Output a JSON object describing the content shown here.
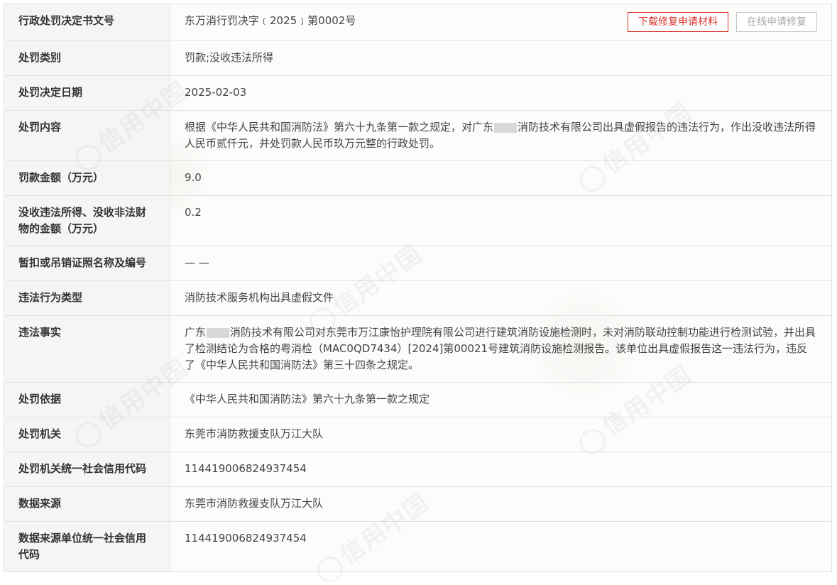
{
  "buttons": {
    "download": "下载修复申请材料",
    "online": "在线申请修复"
  },
  "watermark": "信用中国",
  "rows": {
    "decision_no": {
      "label": "行政处罚决定书文号",
      "value": "东万消行罚决字﹝2025﹞第0002号"
    },
    "category": {
      "label": "处罚类别",
      "value": "罚款;没收违法所得"
    },
    "date": {
      "label": "处罚决定日期",
      "value": "2025-02-03"
    },
    "content": {
      "label": "处罚内容",
      "value_pre": "根据《中华人民共和国消防法》第六十九条第一款之规定，对广东",
      "value_post": "消防技术有限公司出具虚假报告的违法行为，作出没收违法所得人民币贰仟元，并处罚款人民币玖万元整的行政处罚。"
    },
    "fine": {
      "label": "罚款金额（万元）",
      "value": "9.0"
    },
    "confiscation": {
      "label": "没收违法所得、没收非法财物的金额（万元）",
      "value": "0.2"
    },
    "license": {
      "label": "暂扣或吊销证照名称及编号",
      "value": "— —"
    },
    "violation_type": {
      "label": "违法行为类型",
      "value": "消防技术服务机构出具虚假文件"
    },
    "facts": {
      "label": "违法事实",
      "value_pre": "广东",
      "value_post": "消防技术有限公司对东莞市万江康怡护理院有限公司进行建筑消防设施检测时，未对消防联动控制功能进行检测试验，并出具了检测结论为合格的粤消检（MAC0QD7434）[2024]第00021号建筑消防设施检测报告。该单位出具虚假报告这一违法行为，违反了《中华人民共和国消防法》第三十四条之规定。"
    },
    "basis": {
      "label": "处罚依据",
      "value": "《中华人民共和国消防法》第六十九条第一款之规定"
    },
    "authority": {
      "label": "处罚机关",
      "value": "东莞市消防救援支队万江大队"
    },
    "authority_code": {
      "label": "处罚机关统一社会信用代码",
      "value": "114419006824937454"
    },
    "source": {
      "label": "数据来源",
      "value": "东莞市消防救援支队万江大队"
    },
    "source_code": {
      "label": "数据来源单位统一社会信用代码",
      "value": "114419006824937454"
    }
  }
}
